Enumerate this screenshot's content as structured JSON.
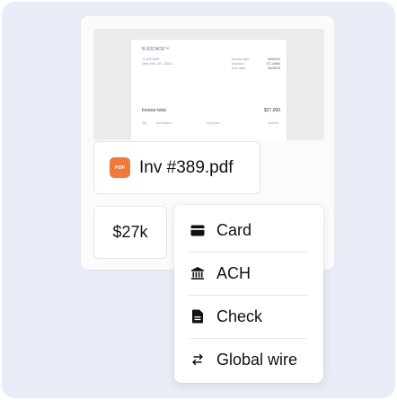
{
  "invoice_preview": {
    "brand": "R.ESTATE™",
    "address_line1": "72 5TH AVE",
    "address_line2": "New York, NY, 10013",
    "meta": [
      {
        "label": "Invoice date",
        "value": "05/03/23"
      },
      {
        "label": "Invoice #",
        "value": "CT-14964"
      },
      {
        "label": "Due date",
        "value": "05/25/23"
      }
    ],
    "total_label": "Invoice total",
    "total_value": "$27,000",
    "columns": [
      "Qty",
      "Description",
      "Unit price",
      "Amount"
    ]
  },
  "attachment": {
    "icon_label": "PDF",
    "file_name": "Inv #389.pdf"
  },
  "amount": {
    "value": "$27k"
  },
  "payment_methods": [
    {
      "label": "Card",
      "icon": "card-icon"
    },
    {
      "label": "ACH",
      "icon": "bank-icon"
    },
    {
      "label": "Check",
      "icon": "document-icon"
    },
    {
      "label": "Global wire",
      "icon": "transfer-icon"
    }
  ],
  "colors": {
    "background": "#e8ecf6",
    "pdf_badge": "#ee7a3b",
    "brand_text": "#4a5b8c"
  }
}
